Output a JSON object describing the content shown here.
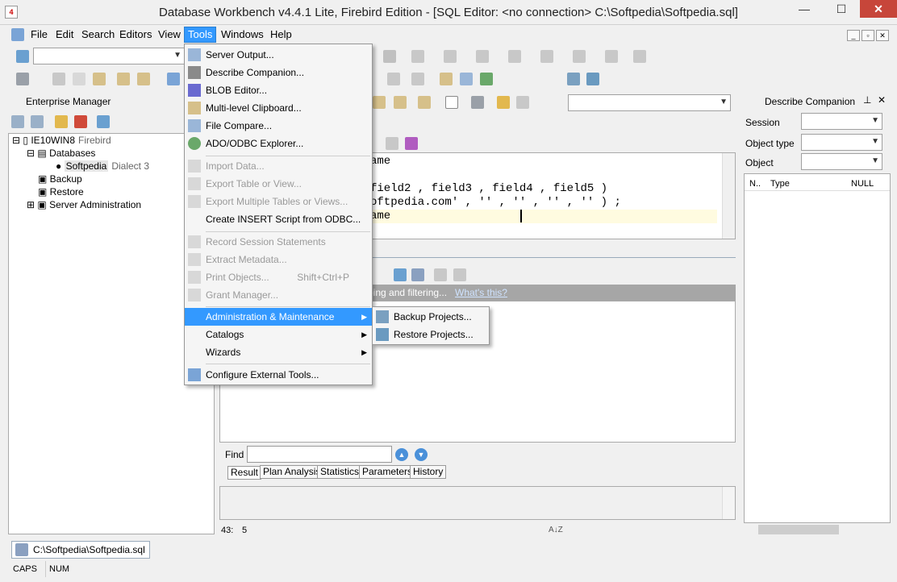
{
  "window": {
    "title": "Database Workbench v4.4.1 Lite, Firebird Edition - [SQL Editor: <no connection>   C:\\Softpedia\\Softpedia.sql]",
    "app_icon_text": "4",
    "controls": [
      "—",
      "☐",
      "✕"
    ]
  },
  "menubar": {
    "items": [
      "File",
      "Edit",
      "Search",
      "Editors",
      "View",
      "Tools",
      "Windows",
      "Help"
    ],
    "active": "Tools"
  },
  "enterprise_manager": {
    "title": "Enterprise Manager",
    "tree": [
      {
        "label": "IE10WIN8",
        "meta": "Firebird"
      },
      {
        "label": "Databases",
        "meta": ""
      },
      {
        "label": "Softpedia",
        "meta": "Dialect 3"
      },
      {
        "label": "Backup",
        "meta": ""
      },
      {
        "label": "Restore",
        "meta": ""
      },
      {
        "label": "Server Administration",
        "meta": ""
      }
    ]
  },
  "tools_menu": {
    "items": [
      {
        "label": "Server Output...",
        "disabled": false
      },
      {
        "label": "Describe Companion...",
        "disabled": false
      },
      {
        "label": "BLOB Editor...",
        "disabled": false
      },
      {
        "label": "Multi-level Clipboard...",
        "disabled": false
      },
      {
        "label": "File Compare...",
        "disabled": false
      },
      {
        "label": "ADO/ODBC Explorer...",
        "disabled": false
      },
      {
        "label": "Import Data...",
        "disabled": true
      },
      {
        "label": "Export Table or View...",
        "disabled": true
      },
      {
        "label": "Export Multiple Tables or Views...",
        "disabled": true
      },
      {
        "label": "Create INSERT Script from ODBC...",
        "disabled": false
      },
      {
        "label": "Record Session Statements",
        "disabled": true
      },
      {
        "label": "Extract Metadata...",
        "disabled": true
      },
      {
        "label": "Print Objects...",
        "disabled": true,
        "shortcut": "Shift+Ctrl+P"
      },
      {
        "label": "Grant Manager...",
        "disabled": true
      },
      {
        "label": "Administration & Maintenance",
        "disabled": false
      },
      {
        "label": "Catalogs",
        "disabled": false
      },
      {
        "label": "Wizards",
        "disabled": false
      },
      {
        "label": "Configure External Tools...",
        "disabled": false
      }
    ],
    "submenu": [
      "Backup Projects...",
      "Restore Projects..."
    ]
  },
  "editor": {
    "lines": [
      "ame",
      "",
      "field2 , field3 , field4 , field5 )",
      "oftpedia.com' , '' , '' , '' , '' ) ;",
      "ame"
    ],
    "hint_text": "ping and filtering...",
    "hint_link": "What's this?",
    "find_label": "Find",
    "find_value": "",
    "tabs": [
      "Result",
      "Plan Analysis",
      "Statistics",
      "Parameters",
      "History"
    ],
    "cursor_pos": "43:",
    "cursor_col": "5",
    "sort_glyph": "A↓Z"
  },
  "describe_companion": {
    "title": "Describe Companion",
    "fields": [
      {
        "label": "Session",
        "value": ""
      },
      {
        "label": "Object type",
        "value": ""
      },
      {
        "label": "Object",
        "value": ""
      }
    ],
    "columns": [
      "N..",
      "Type",
      "NULL"
    ]
  },
  "document_tab": "C:\\Softpedia\\Softpedia.sql",
  "status": [
    "CAPS",
    "NUM"
  ],
  "colors": {
    "highlight": "#3399ff",
    "close": "#c7463a"
  }
}
